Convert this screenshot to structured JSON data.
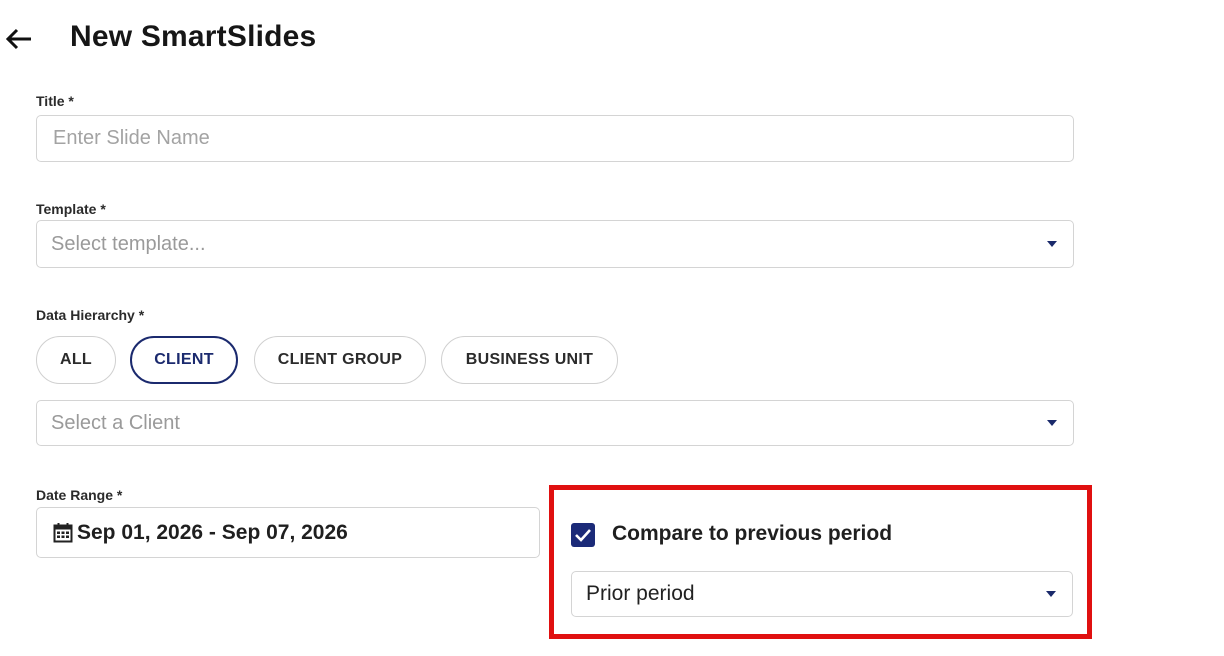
{
  "header": {
    "title": "New SmartSlides",
    "back_icon": "arrow-left-icon"
  },
  "form": {
    "title": {
      "label": "Title *",
      "value": "",
      "placeholder": "Enter Slide Name"
    },
    "template": {
      "label": "Template *",
      "placeholder": "Select template..."
    },
    "data_hierarchy": {
      "label": "Data Hierarchy *",
      "options": [
        "ALL",
        "CLIENT",
        "CLIENT GROUP",
        "BUSINESS UNIT"
      ],
      "selected": "CLIENT",
      "client_select_placeholder": "Select a Client"
    },
    "date_range": {
      "label": "Date Range *",
      "value": "Sep 01, 2026 - Sep 07, 2026",
      "icon": "calendar-icon"
    },
    "compare": {
      "checked": true,
      "label": "Compare to previous period",
      "period_value": "Prior period"
    }
  },
  "colors": {
    "accent": "#1b2a6e",
    "highlight": "#e01010",
    "border": "#d4d4d4"
  }
}
